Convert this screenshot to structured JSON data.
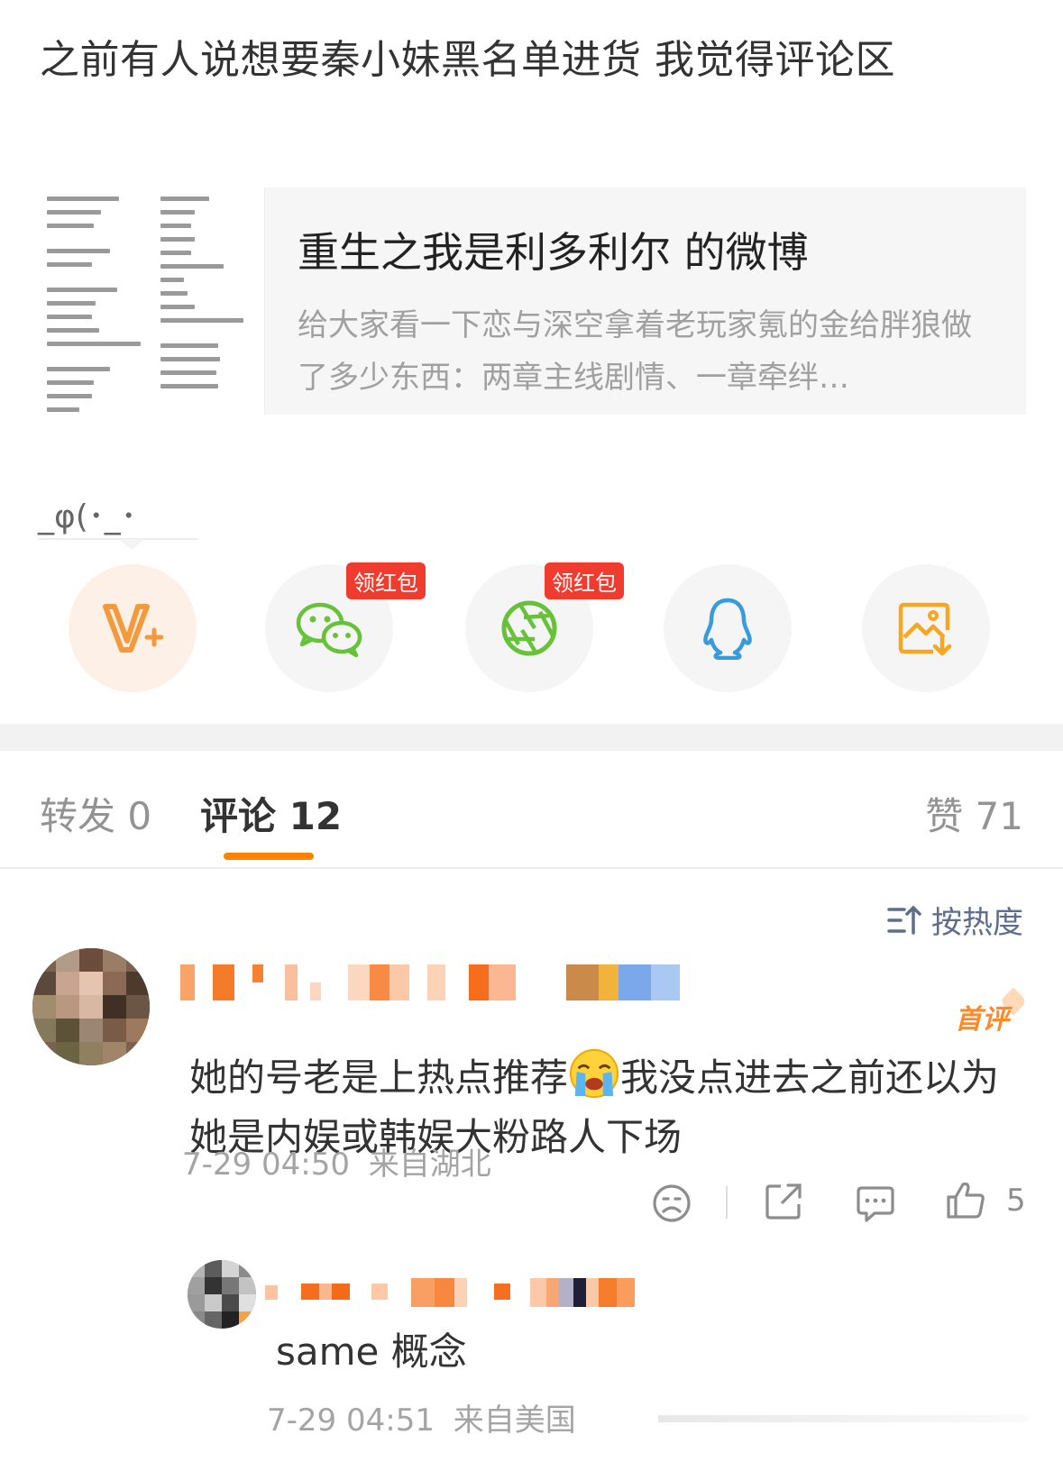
{
  "post": {
    "text": "之前有人说想要秦小妹黑名单进货 我觉得评论区"
  },
  "share_card": {
    "title": "重生之我是利多利尔 的微博",
    "description": "给大家看一下恋与深空拿着老玩家氪的金给胖狼做了多少东西：两章主线剧情、一章牵绊…"
  },
  "emote_line": "_φ(･_･",
  "share_targets": [
    {
      "name": "vplus",
      "icon": "vplus-icon",
      "color": "#f59a3c"
    },
    {
      "name": "wechat",
      "icon": "wechat-icon",
      "color": "#67c23a",
      "badge": "领红包"
    },
    {
      "name": "moments",
      "icon": "moments-icon",
      "color": "#67c23a",
      "badge": "领红包"
    },
    {
      "name": "qq",
      "icon": "qq-icon",
      "color": "#3a9bdc"
    },
    {
      "name": "save-image",
      "icon": "save-image-icon",
      "color": "#f5a623"
    }
  ],
  "tabs": {
    "repost": "转发 0",
    "comments": "评论 12",
    "likes": "赞 71"
  },
  "sort_label": "按热度",
  "comments": [
    {
      "first_tag": "首评",
      "text_before_emoji": "她的号老是上热点推荐",
      "emoji": "crying-face-emoji",
      "text_after_emoji": "我没点进去之前还以为她是内娱或韩娱大粉路人下场",
      "time": "7-29 04:50",
      "location": "来自湖北",
      "like_count": "5",
      "reply": {
        "text": "same 概念",
        "time": "7-29 04:51",
        "location": "来自美国"
      }
    }
  ],
  "colors": {
    "accent": "#ff8200",
    "badge_red": "#f03c2e",
    "muted": "#a4a4a4"
  }
}
